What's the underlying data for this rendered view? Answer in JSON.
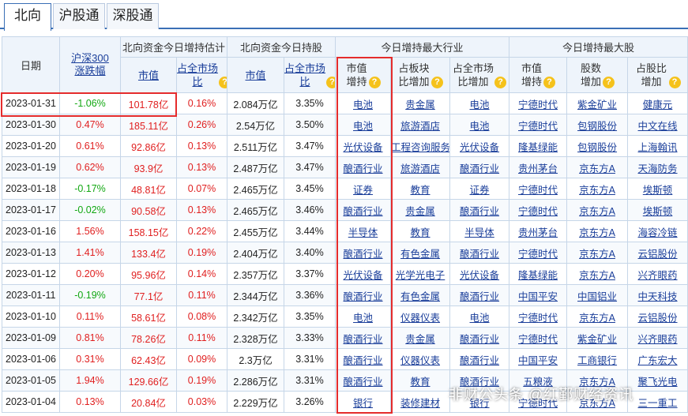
{
  "tabs": [
    "北向",
    "沪股通",
    "深股通"
  ],
  "header": {
    "date": "日期",
    "index": "沪深300涨跌幅",
    "group_est": "北向资金今日增持估计",
    "group_hold": "北向资金今日持股",
    "group_industry": "今日增持最大行业",
    "group_stock": "今日增持最大股",
    "est_value": "市值",
    "est_ratio": "占全市场比",
    "hold_value": "市值",
    "hold_ratio": "占全市场比",
    "ind_value": "市值增持",
    "ind_block": "占板块比增加",
    "ind_market": "占全市场比增加",
    "stk_value": "市值增持",
    "stk_shares": "股数增加",
    "stk_ratio": "占股比增加",
    "help_glyph": "?"
  },
  "rows": [
    {
      "date": "2023-01-31",
      "chg": "-1.06%",
      "dir": "down",
      "est": "101.78亿",
      "est_ratio": "0.16%",
      "hold": "2.084万亿",
      "hold_ratio": "3.35%",
      "ind1": "电池",
      "ind2": "贵金属",
      "ind3": "电池",
      "s1": "宁德时代",
      "s2": "紫金矿业",
      "s3": "健康元"
    },
    {
      "date": "2023-01-30",
      "chg": "0.47%",
      "dir": "up",
      "est": "185.11亿",
      "est_ratio": "0.26%",
      "hold": "2.54万亿",
      "hold_ratio": "3.50%",
      "ind1": "电池",
      "ind2": "旅游酒店",
      "ind3": "电池",
      "s1": "宁德时代",
      "s2": "包钢股份",
      "s3": "中文在线"
    },
    {
      "date": "2023-01-20",
      "chg": "0.61%",
      "dir": "up",
      "est": "92.86亿",
      "est_ratio": "0.13%",
      "hold": "2.511万亿",
      "hold_ratio": "3.47%",
      "ind1": "光伏设备",
      "ind2": "工程咨询服务",
      "ind3": "光伏设备",
      "s1": "隆基绿能",
      "s2": "包钢股份",
      "s3": "上海翰讯"
    },
    {
      "date": "2023-01-19",
      "chg": "0.62%",
      "dir": "up",
      "est": "93.9亿",
      "est_ratio": "0.13%",
      "hold": "2.487万亿",
      "hold_ratio": "3.47%",
      "ind1": "酿酒行业",
      "ind2": "旅游酒店",
      "ind3": "酿酒行业",
      "s1": "贵州茅台",
      "s2": "京东方A",
      "s3": "天海防务"
    },
    {
      "date": "2023-01-18",
      "chg": "-0.17%",
      "dir": "down",
      "est": "48.81亿",
      "est_ratio": "0.07%",
      "hold": "2.465万亿",
      "hold_ratio": "3.45%",
      "ind1": "证券",
      "ind2": "教育",
      "ind3": "证券",
      "s1": "宁德时代",
      "s2": "京东方A",
      "s3": "埃斯顿"
    },
    {
      "date": "2023-01-17",
      "chg": "-0.02%",
      "dir": "down",
      "est": "90.58亿",
      "est_ratio": "0.13%",
      "hold": "2.465万亿",
      "hold_ratio": "3.46%",
      "ind1": "酿酒行业",
      "ind2": "贵金属",
      "ind3": "酿酒行业",
      "s1": "宁德时代",
      "s2": "京东方A",
      "s3": "埃斯顿"
    },
    {
      "date": "2023-01-16",
      "chg": "1.56%",
      "dir": "up",
      "est": "158.15亿",
      "est_ratio": "0.22%",
      "hold": "2.455万亿",
      "hold_ratio": "3.44%",
      "ind1": "半导体",
      "ind2": "教育",
      "ind3": "半导体",
      "s1": "贵州茅台",
      "s2": "京东方A",
      "s3": "海容冷链"
    },
    {
      "date": "2023-01-13",
      "chg": "1.41%",
      "dir": "up",
      "est": "133.4亿",
      "est_ratio": "0.19%",
      "hold": "2.404万亿",
      "hold_ratio": "3.40%",
      "ind1": "酿酒行业",
      "ind2": "有色金属",
      "ind3": "酿酒行业",
      "s1": "宁德时代",
      "s2": "京东方A",
      "s3": "云铝股份"
    },
    {
      "date": "2023-01-12",
      "chg": "0.20%",
      "dir": "up",
      "est": "95.96亿",
      "est_ratio": "0.14%",
      "hold": "2.357万亿",
      "hold_ratio": "3.37%",
      "ind1": "光伏设备",
      "ind2": "光学光电子",
      "ind3": "光伏设备",
      "s1": "隆基绿能",
      "s2": "京东方A",
      "s3": "兴齐眼药"
    },
    {
      "date": "2023-01-11",
      "chg": "-0.19%",
      "dir": "down",
      "est": "77.1亿",
      "est_ratio": "0.11%",
      "hold": "2.344万亿",
      "hold_ratio": "3.36%",
      "ind1": "酿酒行业",
      "ind2": "有色金属",
      "ind3": "酿酒行业",
      "s1": "中国平安",
      "s2": "中国铝业",
      "s3": "中天科技"
    },
    {
      "date": "2023-01-10",
      "chg": "0.11%",
      "dir": "up",
      "est": "58.61亿",
      "est_ratio": "0.08%",
      "hold": "2.342万亿",
      "hold_ratio": "3.35%",
      "ind1": "电池",
      "ind2": "仪器仪表",
      "ind3": "电池",
      "s1": "宁德时代",
      "s2": "京东方A",
      "s3": "云铝股份"
    },
    {
      "date": "2023-01-09",
      "chg": "0.81%",
      "dir": "up",
      "est": "78.26亿",
      "est_ratio": "0.11%",
      "hold": "2.328万亿",
      "hold_ratio": "3.33%",
      "ind1": "酿酒行业",
      "ind2": "贵金属",
      "ind3": "酿酒行业",
      "s1": "宁德时代",
      "s2": "紫金矿业",
      "s3": "兴齐眼药"
    },
    {
      "date": "2023-01-06",
      "chg": "0.31%",
      "dir": "up",
      "est": "62.43亿",
      "est_ratio": "0.09%",
      "hold": "2.3万亿",
      "hold_ratio": "3.31%",
      "ind1": "酿酒行业",
      "ind2": "仪器仪表",
      "ind3": "酿酒行业",
      "s1": "中国平安",
      "s2": "工商银行",
      "s3": "广东宏大"
    },
    {
      "date": "2023-01-05",
      "chg": "1.94%",
      "dir": "up",
      "est": "129.66亿",
      "est_ratio": "0.19%",
      "hold": "2.286万亿",
      "hold_ratio": "3.31%",
      "ind1": "酿酒行业",
      "ind2": "教育",
      "ind3": "酿酒行业",
      "s1": "五粮液",
      "s2": "京东方A",
      "s3": "聚飞光电"
    },
    {
      "date": "2023-01-04",
      "chg": "0.13%",
      "dir": "up",
      "est": "20.84亿",
      "est_ratio": "0.03%",
      "hold": "2.229万亿",
      "hold_ratio": "3.26%",
      "ind1": "银行",
      "ind2": "装修建材",
      "ind3": "银行",
      "s1": "宁德时代",
      "s2": "京东方A",
      "s3": "三一重工"
    }
  ],
  "watermark": "非财公头条 @红鄞财经资讯"
}
